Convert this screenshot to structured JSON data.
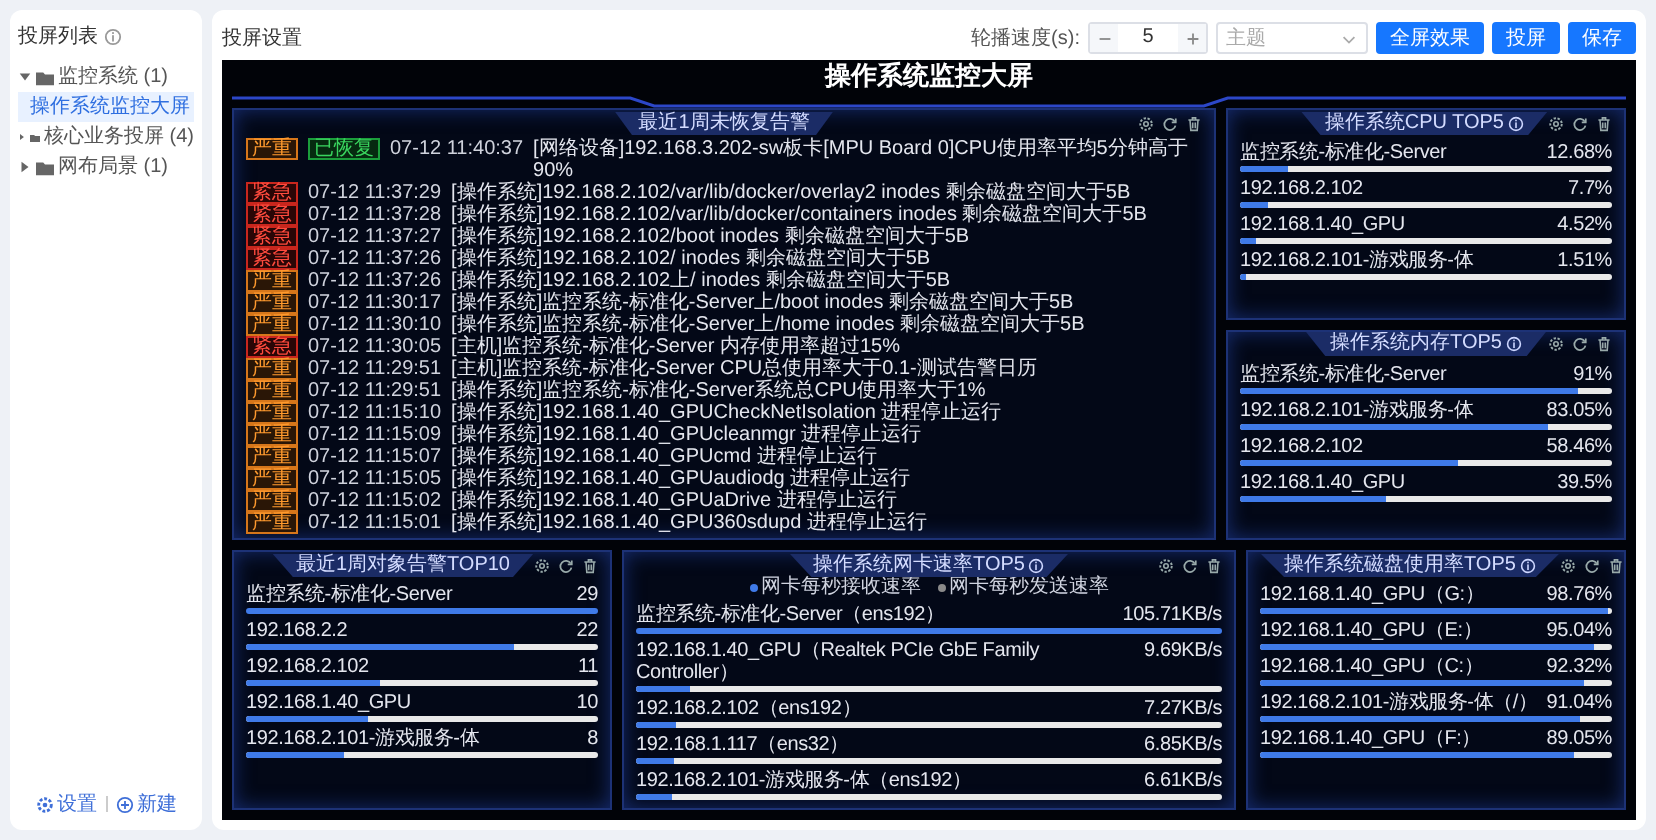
{
  "sidebar": {
    "title": "投屏列表",
    "groups": [
      {
        "label": "监控系统",
        "count": "(1)",
        "expanded": true,
        "children": [
          {
            "label": "操作系统监控大屏",
            "selected": true
          }
        ]
      },
      {
        "label": "核心业务投屏",
        "count": "(4)",
        "expanded": false
      },
      {
        "label": "网布局景",
        "count": "(1)",
        "expanded": false
      }
    ],
    "footer": [
      "设置",
      "新建"
    ]
  },
  "toolbar": {
    "title": "投屏设置",
    "speed_label": "轮播速度(s):",
    "speed": "5",
    "theme_placeholder": "主题",
    "buttons": [
      "全屏效果",
      "投屏",
      "保存"
    ]
  },
  "screen": {
    "title": "操作系统监控大屏",
    "alarm_panel": {
      "title": "最近1周未恢复告警",
      "rows": [
        {
          "kind": "major",
          "level": "严重",
          "status": "已恢复",
          "time": "07-12 11:40:37",
          "message": "[网络设备]192.168.3.202-sw板卡[MPU Board 0]CPU使用率平均5分钟高于90%"
        },
        {
          "kind": "critical",
          "level": "紧急",
          "time": "07-12 11:37:29",
          "message": "[操作系统]192.168.2.102/var/lib/docker/overlay2 inodes 剩余磁盘空间大于5B"
        },
        {
          "kind": "critical",
          "level": "紧急",
          "time": "07-12 11:37:28",
          "message": "[操作系统]192.168.2.102/var/lib/docker/containers inodes 剩余磁盘空间大于5B"
        },
        {
          "kind": "critical",
          "level": "紧急",
          "time": "07-12 11:37:27",
          "message": "[操作系统]192.168.2.102/boot inodes 剩余磁盘空间大于5B"
        },
        {
          "kind": "critical",
          "level": "紧急",
          "time": "07-12 11:37:26",
          "message": "[操作系统]192.168.2.102/ inodes 剩余磁盘空间大于5B"
        },
        {
          "kind": "major",
          "level": "严重",
          "time": "07-12 11:37:26",
          "message": "[操作系统]192.168.2.102上/ inodes 剩余磁盘空间大于5B"
        },
        {
          "kind": "major",
          "level": "严重",
          "time": "07-12 11:30:17",
          "message": "[操作系统]监控系统-标准化-Server上/boot inodes 剩余磁盘空间大于5B"
        },
        {
          "kind": "major",
          "level": "严重",
          "time": "07-12 11:30:10",
          "message": "[操作系统]监控系统-标准化-Server上/home inodes 剩余磁盘空间大于5B"
        },
        {
          "kind": "critical",
          "level": "紧急",
          "time": "07-12 11:30:05",
          "message": "[主机]监控系统-标准化-Server 内存使用率超过15%"
        },
        {
          "kind": "major",
          "level": "严重",
          "time": "07-12 11:29:51",
          "message": "[主机]监控系统-标准化-Server CPU总使用率大于0.1-测试告警日历"
        },
        {
          "kind": "major",
          "level": "严重",
          "time": "07-12 11:29:51",
          "message": "[操作系统]监控系统-标准化-Server系统总CPU使用率大于1%"
        },
        {
          "kind": "major",
          "level": "严重",
          "time": "07-12 11:15:10",
          "message": "[操作系统]192.168.1.40_GPUCheckNetIsolation 进程停止运行"
        },
        {
          "kind": "major",
          "level": "严重",
          "time": "07-12 11:15:09",
          "message": "[操作系统]192.168.1.40_GPUcleanmgr 进程停止运行"
        },
        {
          "kind": "major",
          "level": "严重",
          "time": "07-12 11:15:07",
          "message": "[操作系统]192.168.1.40_GPUcmd 进程停止运行"
        },
        {
          "kind": "major",
          "level": "严重",
          "time": "07-12 11:15:05",
          "message": "[操作系统]192.168.1.40_GPUaudiodg 进程停止运行"
        },
        {
          "kind": "major",
          "level": "严重",
          "time": "07-12 11:15:02",
          "message": "[操作系统]192.168.1.40_GPUaDrive 进程停止运行"
        },
        {
          "kind": "major",
          "level": "严重",
          "time": "07-12 11:15:01",
          "message": "[操作系统]192.168.1.40_GPU360sdupd 进程停止运行"
        }
      ]
    },
    "side_panels": [
      {
        "title": "操作系统CPU TOP5",
        "info": true,
        "items": [
          {
            "label": "监控系统-标准化-Server",
            "value": "12.68%",
            "level": 0.127
          },
          {
            "label": "192.168.2.102",
            "value": "7.7%",
            "level": 0.077
          },
          {
            "label": "192.168.1.40_GPU",
            "value": "4.52%",
            "level": 0.045
          },
          {
            "label": "192.168.2.101-游戏服务-体",
            "value": "1.51%",
            "level": 0.015
          }
        ]
      },
      {
        "title": "操作系统内存TOP5",
        "info": true,
        "items": [
          {
            "label": "监控系统-标准化-Server",
            "value": "91%",
            "level": 0.91
          },
          {
            "label": "192.168.2.101-游戏服务-体",
            "value": "83.05%",
            "level": 0.83
          },
          {
            "label": "192.168.2.102",
            "value": "58.46%",
            "level": 0.585
          },
          {
            "label": "192.168.1.40_GPU",
            "value": "39.5%",
            "level": 0.395
          }
        ]
      }
    ],
    "bottom_panels": [
      {
        "title": "最近1周对象告警TOP10",
        "info": false,
        "items": [
          {
            "label": "监控系统-标准化-Server",
            "value": "29",
            "level": 1
          },
          {
            "label": "192.168.2.2",
            "value": "22",
            "level": 0.76
          },
          {
            "label": "192.168.2.102",
            "value": "11",
            "level": 0.38
          },
          {
            "label": "192.168.1.40_GPU",
            "value": "10",
            "level": 0.345
          },
          {
            "label": "192.168.2.101-游戏服务-体",
            "value": "8",
            "level": 0.28
          }
        ]
      },
      {
        "title": "操作系统网卡速率TOP5",
        "info": true,
        "legend": [
          {
            "label": "网卡每秒接收速率",
            "color": "#3f7ae8"
          },
          {
            "label": "网卡每秒发送速率",
            "color": "#8a8a8a"
          }
        ],
        "items": [
          {
            "label": "监控系统-标准化-Server（ens192）",
            "value": "105.71KB/s",
            "level": 1
          },
          {
            "label": "192.168.1.40_GPU（Realtek PCIe GbE Family Controller）",
            "value": "9.69KB/s",
            "level": 0.092
          },
          {
            "label": "192.168.2.102（ens192）",
            "value": "7.27KB/s",
            "level": 0.069
          },
          {
            "label": "192.168.1.117（ens32）",
            "value": "6.85KB/s",
            "level": 0.065
          },
          {
            "label": "192.168.2.101-游戏服务-体（ens192）",
            "value": "6.61KB/s",
            "level": 0.063
          }
        ]
      },
      {
        "title": "操作系统磁盘使用率TOP5",
        "info": true,
        "items": [
          {
            "label": "192.168.1.40_GPU（G:）",
            "value": "98.76%",
            "level": 0.988
          },
          {
            "label": "192.168.1.40_GPU（E:）",
            "value": "95.04%",
            "level": 0.95
          },
          {
            "label": "192.168.1.40_GPU（C:）",
            "value": "92.32%",
            "level": 0.923
          },
          {
            "label": "192.168.2.101-游戏服务-体（/）",
            "value": "91.04%",
            "level": 0.91
          },
          {
            "label": "192.168.1.40_GPU（F:）",
            "value": "89.05%",
            "level": 0.89
          }
        ]
      }
    ]
  }
}
